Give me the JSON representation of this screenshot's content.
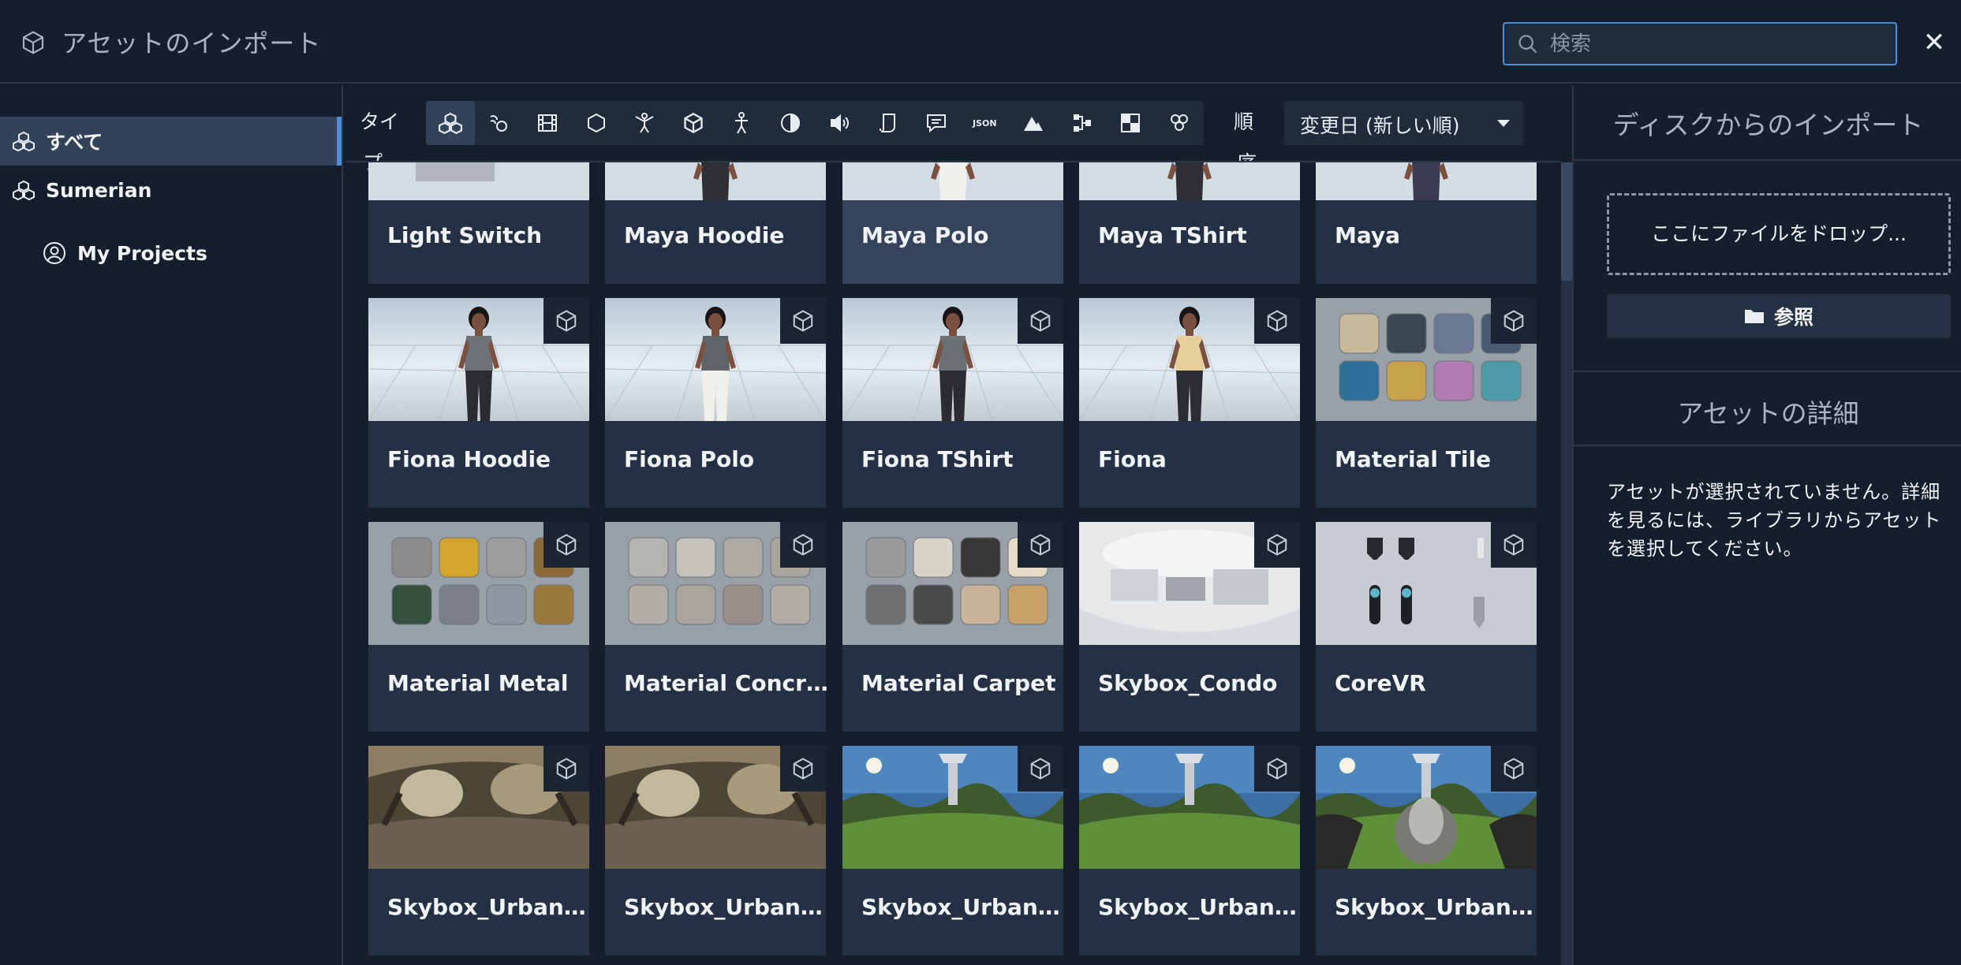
{
  "header": {
    "title": "アセットのインポート",
    "search_placeholder": "検索",
    "close_label": "✕"
  },
  "sidebar": {
    "items": [
      {
        "label": "すべて"
      },
      {
        "label": "Sumerian"
      },
      {
        "label": "My Projects"
      }
    ]
  },
  "toolbar": {
    "type_label_1": "タイ",
    "type_label_2": "プ",
    "order_label_1": "順",
    "order_label_2": "序",
    "json_label": "JSON",
    "sort_value": "変更日 (新しい順)"
  },
  "assets": [
    {
      "name": "Light Switch",
      "thumb": "partial-dark"
    },
    {
      "name": "Maya Hoodie",
      "thumb": "partial-person"
    },
    {
      "name": "Maya Polo",
      "thumb": "partial-person",
      "selected": true
    },
    {
      "name": "Maya TShirt",
      "thumb": "partial-person"
    },
    {
      "name": "Maya",
      "thumb": "partial-person"
    },
    {
      "name": "Fiona Hoodie",
      "thumb": "person"
    },
    {
      "name": "Fiona Polo",
      "thumb": "person"
    },
    {
      "name": "Fiona TShirt",
      "thumb": "person"
    },
    {
      "name": "Fiona",
      "thumb": "person"
    },
    {
      "name": "Material Tile",
      "thumb": "material"
    },
    {
      "name": "Material Metal",
      "thumb": "material"
    },
    {
      "name": "Material Concr…",
      "thumb": "material"
    },
    {
      "name": "Material Carpet",
      "thumb": "material"
    },
    {
      "name": "Skybox_Condo",
      "thumb": "room"
    },
    {
      "name": "CoreVR",
      "thumb": "controllers"
    },
    {
      "name": "Skybox_Urban…",
      "thumb": "urban"
    },
    {
      "name": "Skybox_Urban…",
      "thumb": "urban"
    },
    {
      "name": "Skybox_Urban…",
      "thumb": "park"
    },
    {
      "name": "Skybox_Urban…",
      "thumb": "park"
    },
    {
      "name": "Skybox_Urban…",
      "thumb": "park2"
    }
  ],
  "right_panel": {
    "import_title": "ディスクからのインポート",
    "drop_text": "ここにファイルをドロップ...",
    "browse_label": "参照",
    "details_title": "アセットの詳細",
    "details_text": "アセットが選択されていません。詳細を見るには、ライブラリからアセットを選択してください。"
  },
  "colors": {
    "accent": "#4c8fd6",
    "background": "#161e2d",
    "card": "#243043",
    "selected": "#35445c"
  }
}
